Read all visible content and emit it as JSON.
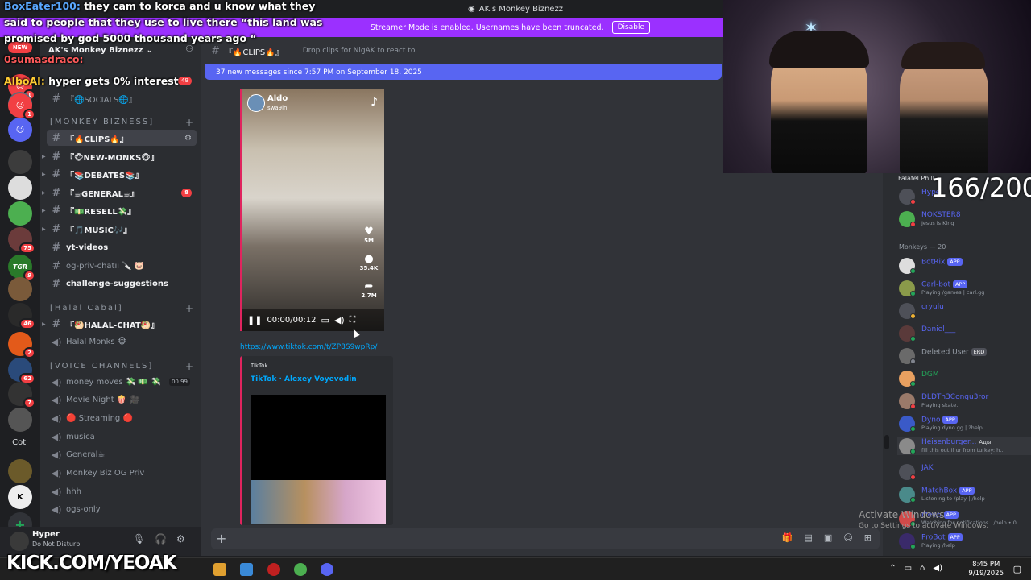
{
  "titlebar": {
    "title": "AK's Monkey Biznezz"
  },
  "streamer_banner": {
    "text": "Streamer Mode is enabled. Usernames have been truncated.",
    "button": "Disable"
  },
  "kick_chat": [
    {
      "user": "BoxEater100:",
      "text": " they cam to korca and u know what they"
    },
    {
      "user": "",
      "text": "said to people that they use to live there “this land was"
    },
    {
      "user": "",
      "text": "promised by god 5000 thousand years ago “"
    },
    {
      "user": "0sumasdraco:",
      "text": ""
    },
    {
      "user": "AlboAI:",
      "text": " hyper gets 0% interest"
    }
  ],
  "rail": {
    "servers": [
      {
        "badge": "1"
      },
      {
        "badge": "1"
      },
      {
        "badge": ""
      },
      {
        "badge": ""
      },
      {
        "badge": ""
      },
      {
        "badge": "75"
      },
      {
        "badge": "9"
      },
      {
        "badge": ""
      },
      {
        "badge": "46"
      },
      {
        "badge": "2"
      },
      {
        "badge": "62"
      },
      {
        "badge": "7"
      },
      {
        "badge": ""
      }
    ],
    "cotl_label": "Cotl",
    "new_badge": "NEW"
  },
  "sidebar": {
    "server_name": "AK's Monkey Biznezz",
    "channel_top": "『🌐SOCIALS🌐』",
    "cat_monkey": "[MONKEY BIZNESS]",
    "channels_monkey": [
      {
        "name": "『🔥CLIPS🔥』",
        "badge": ""
      },
      {
        "name": "『🐵NEW-MONKS🐵』",
        "badge": ""
      },
      {
        "name": "『📚DEBATES📚』",
        "badge": ""
      },
      {
        "name": "『☕GENERAL☕』",
        "badge": "8"
      },
      {
        "name": "『💵RESELL💸』",
        "badge": ""
      },
      {
        "name": "『🎵MUSIC🎶』",
        "badge": ""
      },
      {
        "name": "yt-videos",
        "badge": ""
      },
      {
        "name": "og-priv-chatıı 🔪 🐷",
        "badge": ""
      },
      {
        "name": "challenge-suggestions",
        "badge": ""
      }
    ],
    "cat_halal": "[Halal Cabal]",
    "channels_halal": [
      {
        "name": "『🥙HALAL-CHAT🥙』"
      },
      {
        "name": "Halal Monks 🐵"
      }
    ],
    "cat_voice": "[VOICE CHANNELS]",
    "voice_channels": [
      {
        "name": "money moves 💸 💵 💸",
        "count": "00  99"
      },
      {
        "name": "Movie Night 🍿 🎥",
        "count": ""
      },
      {
        "name": "🔴 Streaming 🔴",
        "count": ""
      },
      {
        "name": "musica",
        "count": ""
      },
      {
        "name": "General☕",
        "count": ""
      },
      {
        "name": "Monkey Biz OG Priv",
        "count": ""
      },
      {
        "name": "hhh",
        "count": ""
      },
      {
        "name": "ogs-only",
        "count": ""
      }
    ],
    "room_badge_top": "49"
  },
  "user_panel": {
    "name": "Hyper",
    "status": "Do Not Disturb"
  },
  "chat": {
    "channel": "『🔥CLIPS🔥』",
    "topic": "Drop clips for NigAK to react to.",
    "new_messages": "37 new messages since 7:57 PM on September 18, 2025",
    "video": {
      "user": "Aldo",
      "handle": "swa9in",
      "likes": "5M",
      "comments": "35.4K",
      "shares": "2.7M",
      "time": "00:00/00:12"
    },
    "link": "https://www.tiktok.com/t/ZP8S9wpRp/",
    "link_embed": {
      "provider": "TikTok",
      "title": "TikTok · Alexey Voyevodin"
    }
  },
  "webcam": {
    "label": "Falafel Phill"
  },
  "sub_counter": "166/200",
  "members": {
    "top": [
      {
        "name": "Hype",
        "sub": "",
        "color": "#5865f2",
        "dot": "#f23f43"
      },
      {
        "name": "NOKSTER8",
        "sub": "Jesus is King",
        "color": "#5865f2",
        "dot": "#f23f43"
      }
    ],
    "monkeys_header": "Monkeys — 20",
    "monkeys": [
      {
        "name": "BotRix",
        "sub": "",
        "app": "APP",
        "dot": "#23a559"
      },
      {
        "name": "Carl-bot",
        "sub": "Playing /games | carl.gg",
        "app": "APP",
        "dot": "#23a559"
      },
      {
        "name": "cryulu",
        "sub": "",
        "app": "",
        "dot": "#f0b232"
      },
      {
        "name": "Daniel___",
        "sub": "",
        "app": "",
        "dot": "#23a559"
      },
      {
        "name": "Deleted User",
        "sub": "",
        "app": "ERD",
        "dot": "#80848e"
      },
      {
        "name": "DGM",
        "sub": "",
        "app": "",
        "dot": "#23a559"
      },
      {
        "name": "DLDTh3Conqu3ror",
        "sub": "Playing skate.",
        "app": "",
        "dot": "#f23f43"
      },
      {
        "name": "Dyno",
        "sub": "Playing dyno.gg | ?help",
        "app": "APP",
        "dot": "#23a559"
      },
      {
        "name": "Heisenburger...",
        "sub": "fill this out if ur from turkey: h...",
        "app": "",
        "dot": "#23a559"
      },
      {
        "name": "JAK",
        "sub": "",
        "app": "",
        "dot": "#f23f43"
      },
      {
        "name": "MatchBox",
        "sub": "Listening to /play | /help",
        "app": "APP",
        "dot": "#23a559"
      },
      {
        "name": "Mee6",
        "sub": "Watching for notifications.. /help • 0",
        "app": "APP",
        "dot": "#23a559"
      },
      {
        "name": "ProBot",
        "sub": "Playing /help",
        "app": "APP",
        "dot": "#23a559"
      }
    ],
    "heisen_tag": "Адыг"
  },
  "overlays": {
    "kick_watermark": "KICK.COM/YEOAK",
    "activate_1": "Activate Windows",
    "activate_2": "Go to Settings to activate Windows."
  },
  "taskbar": {
    "time": "8:45 PM",
    "date": "9/19/2025"
  }
}
